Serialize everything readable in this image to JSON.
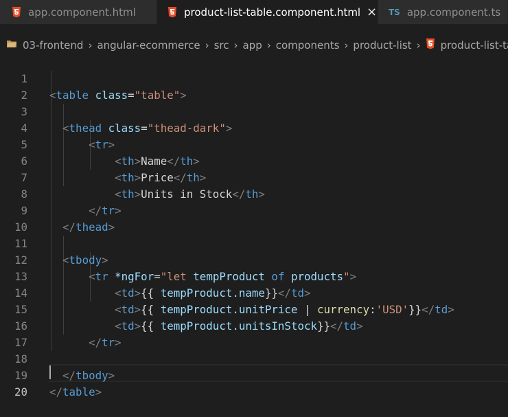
{
  "tabs": [
    {
      "label": "app.component.html",
      "icon": "html5-icon",
      "active": false
    },
    {
      "label": "product-list-table.component.html",
      "icon": "html5-icon",
      "active": true,
      "close": "×"
    },
    {
      "label": "app.component.ts",
      "icon": "ts-icon",
      "icon_text": "TS",
      "active": false
    }
  ],
  "breadcrumb": [
    "03-frontend",
    "angular-ecommerce",
    "src",
    "app",
    "components",
    "product-list",
    "product-list-table.component.html"
  ],
  "colors": {
    "html_icon": "#e44d26",
    "ts_icon": "#519aba",
    "tag": "#569cd6",
    "attribute": "#9cdcfe",
    "string": "#ce9178",
    "pipe": "#dcdcaa"
  },
  "lines": [
    {
      "n": "1"
    },
    {
      "n": "2"
    },
    {
      "n": "3"
    },
    {
      "n": "4"
    },
    {
      "n": "5"
    },
    {
      "n": "6"
    },
    {
      "n": "7"
    },
    {
      "n": "8"
    },
    {
      "n": "9"
    },
    {
      "n": "10"
    },
    {
      "n": "11"
    },
    {
      "n": "12"
    },
    {
      "n": "13"
    },
    {
      "n": "14"
    },
    {
      "n": "15"
    },
    {
      "n": "16"
    },
    {
      "n": "17"
    },
    {
      "n": "18"
    },
    {
      "n": "19"
    },
    {
      "n": "20"
    }
  ],
  "code": {
    "l1": {
      "tag": "table",
      "attr": "class",
      "value": "\"table\""
    },
    "l3": {
      "tag": "thead",
      "attr": "class",
      "value": "\"thead-dark\""
    },
    "l4": {
      "tag": "tr"
    },
    "l5": {
      "tag": "th",
      "text": "Name"
    },
    "l6": {
      "tag": "th",
      "text": "Price"
    },
    "l7": {
      "tag": "th",
      "text": "Units in Stock"
    },
    "l8": {
      "tag": "tr"
    },
    "l9": {
      "tag": "thead"
    },
    "l11": {
      "tag": "tbody"
    },
    "l12": {
      "tag": "tr",
      "attr": "*ngFor",
      "value_open": "\"let ",
      "var": "tempProduct",
      "kw": " of ",
      "list": "products",
      "value_close": "\""
    },
    "l13": {
      "tag": "td",
      "open": "{{ ",
      "expr": "tempProduct.name",
      "close": "}}"
    },
    "l14": {
      "tag": "td",
      "open": "{{ ",
      "expr": "tempProduct.unitPrice",
      "bar": " | ",
      "pipe": "currency",
      "colon": ":",
      "arg": "'USD'",
      "close": "}}"
    },
    "l15": {
      "tag": "td",
      "open": "{{ ",
      "expr": "tempProduct.unitsInStock",
      "close": "}}"
    },
    "l16": {
      "tag": "tr"
    },
    "l18": {
      "tag": "tbody"
    },
    "l19": {
      "tag": "table"
    }
  }
}
